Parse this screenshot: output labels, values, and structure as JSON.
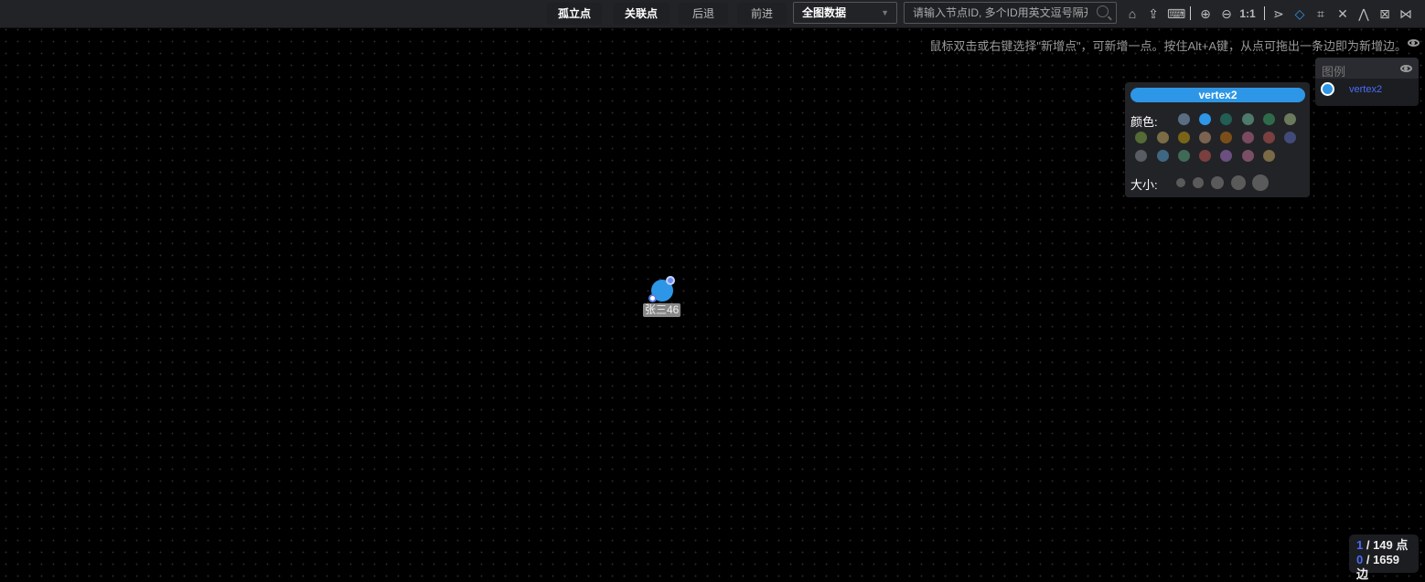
{
  "toolbar": {
    "isolated": "孤立点",
    "related": "关联点",
    "back": "后退",
    "forward": "前进",
    "scope": "全图数据",
    "search_placeholder": "请输入节点ID, 多个ID用英文逗号隔开",
    "zoom_reset": "1:1"
  },
  "hint": "鼠标双击或右键选择\"新增点\"，可新增一点。按住Alt+A键，从点可拖出一条边即为新增边。",
  "legend": {
    "title": "图例",
    "items": [
      {
        "label": "vertex2",
        "color": "#2d96e6"
      }
    ]
  },
  "style_panel": {
    "title": "vertex2",
    "color_label": "颜色:",
    "size_label": "大小:",
    "colors": [
      "#5a6e83",
      "#2d96e6",
      "#235e55",
      "#4e7a6c",
      "#2f6b4a",
      "#6b7a5c",
      "#556b35",
      "#7a6c45",
      "#7a6418",
      "#7a6450",
      "#7a4e1a",
      "#7a4a60",
      "#7a3f3f",
      "#424a7a",
      "#5a5c64",
      "#3f6782",
      "#3f6a55",
      "#7a3f3f",
      "#6a4f80",
      "#7a4f65",
      "#7a6a45"
    ],
    "sizes": [
      1,
      2,
      3,
      4,
      5
    ],
    "accent": "#2d96e6"
  },
  "node": {
    "label": "张三46",
    "color": "#2d96e6"
  },
  "counter": {
    "nodes_selected": "1",
    "nodes_total": " / 149 点",
    "edges_selected": "0",
    "edges_total": " / 1659 边"
  }
}
